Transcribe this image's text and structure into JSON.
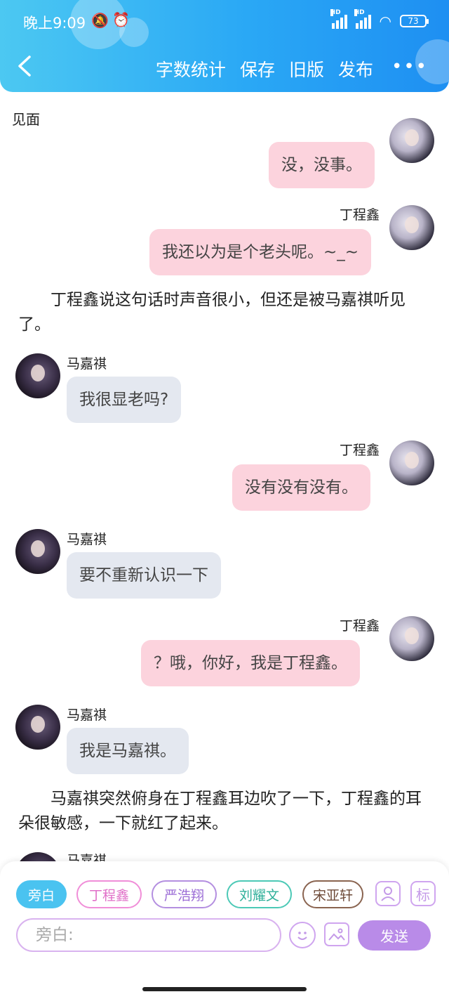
{
  "status_bar": {
    "time": "晚上9:09",
    "battery": "73",
    "hd1": "HD",
    "hd2": "HD"
  },
  "nav": {
    "back": "‹",
    "word_count": "字数统计",
    "save": "保存",
    "old_version": "旧版",
    "publish": "发布",
    "more": "•••"
  },
  "chapter_title": "见面",
  "messages": {
    "m1": {
      "text": "没，没事。"
    },
    "m2": {
      "name": "丁程鑫",
      "text": "我还以为是个老头呢。~_~"
    },
    "n1": "丁程鑫说这句话时声音很小，但还是被马嘉祺听见了。",
    "m3": {
      "name": "马嘉祺",
      "text": "我很显老吗?"
    },
    "m4": {
      "name": "丁程鑫",
      "text": "没有没有没有。"
    },
    "m5": {
      "name": "马嘉祺",
      "text": "要不重新认识一下"
    },
    "m6": {
      "name": "丁程鑫",
      "text": "？哦，你好，我是丁程鑫。"
    },
    "m7": {
      "name": "马嘉祺",
      "text": "我是马嘉祺。"
    },
    "n2": "马嘉祺突然俯身在丁程鑫耳边吹了一下，丁程鑫的耳朵很敏感，一下就红了起来。",
    "m8": {
      "name": "马嘉祺"
    }
  },
  "roles": [
    "旁白",
    "丁程鑫",
    "严浩翔",
    "刘耀文",
    "宋亚轩"
  ],
  "tools": {
    "mark": "标"
  },
  "input": {
    "placeholder": "旁白:"
  },
  "send_label": "发送",
  "colors": {
    "header_start": "#4cc8f2",
    "header_end": "#1e8ff2",
    "pink_bubble": "#fcd3dd",
    "gray_bubble": "#e4e8f0",
    "send": "#b98be8"
  }
}
